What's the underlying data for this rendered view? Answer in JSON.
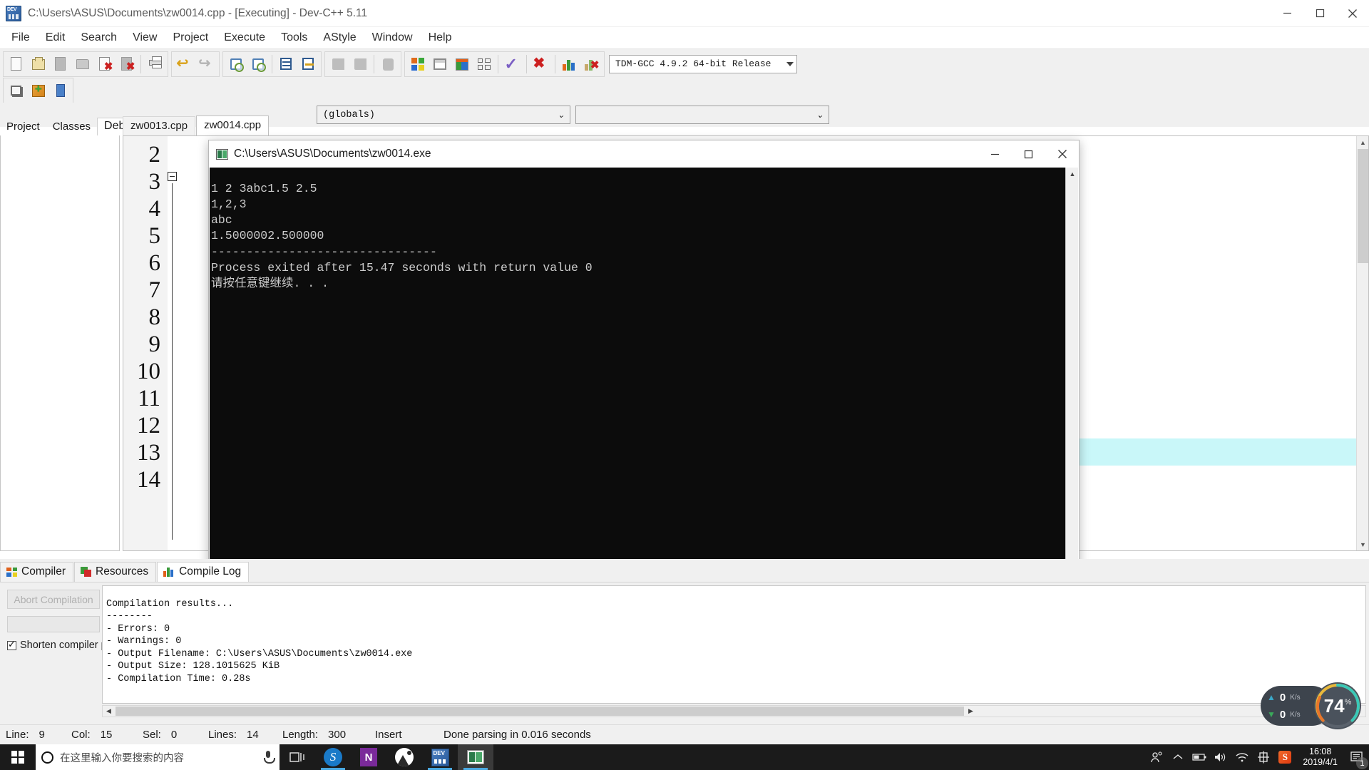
{
  "window": {
    "title": "C:\\Users\\ASUS\\Documents\\zw0014.cpp - [Executing] - Dev-C++ 5.11",
    "minimize": "–",
    "maximize": "☐",
    "close": "✕"
  },
  "menubar": {
    "items": [
      "File",
      "Edit",
      "Search",
      "View",
      "Project",
      "Execute",
      "Tools",
      "AStyle",
      "Window",
      "Help"
    ]
  },
  "toolbar": {
    "compiler_select": "TDM-GCC 4.9.2 64-bit Release",
    "buttons": [
      "new-file",
      "open-file",
      "save-file",
      "save-all",
      "close-file",
      "close-all",
      "print",
      "undo",
      "redo",
      "find",
      "replace",
      "goto-line",
      "goto-function",
      "cut",
      "copy",
      "paste",
      "compile",
      "run",
      "compile-and-run",
      "rebuild-all",
      "check-syntax",
      "stop-execution",
      "profile-analysis",
      "delete-profile"
    ]
  },
  "combos": {
    "scope": "(globals)",
    "member": ""
  },
  "left_tabs": {
    "items": [
      "Project",
      "Classes",
      "Debug"
    ],
    "active": "Debug"
  },
  "editor_tabs": {
    "items": [
      "zw0013.cpp",
      "zw0014.cpp"
    ],
    "active": "zw0014.cpp"
  },
  "editor": {
    "line_numbers": [
      "2",
      "3",
      "4",
      "5",
      "6",
      "7",
      "8",
      "9",
      "10",
      "11",
      "12",
      "13",
      "14"
    ],
    "highlight_color": "#c9f7f9"
  },
  "console": {
    "title": "C:\\Users\\ASUS\\Documents\\zw0014.exe",
    "minimize": "–",
    "maximize": "☐",
    "close": "✕",
    "output": "1 2 3abc1.5 2.5\n1,2,3\nabc\n1.5000002.500000\n--------------------------------\nProcess exited after 15.47 seconds with return value 0\n请按任意键继续. . .",
    "background": "#0c0c0c",
    "foreground": "#cccccc"
  },
  "bottom_tabs": {
    "items": [
      "Compiler",
      "Resources",
      "Compile Log"
    ],
    "active": "Compile Log"
  },
  "bottom_panel": {
    "abort_label": "Abort Compilation",
    "shorten_label": "Shorten compiler pa",
    "shorten_checked": true,
    "results": "Compilation results...\n--------\n- Errors: 0\n- Warnings: 0\n- Output Filename: C:\\Users\\ASUS\\Documents\\zw0014.exe\n- Output Size: 128.1015625 KiB\n- Compilation Time: 0.28s"
  },
  "statusbar": {
    "line_key": "Line:",
    "line_val": "9",
    "col_key": "Col:",
    "col_val": "15",
    "sel_key": "Sel:",
    "sel_val": "0",
    "lines_key": "Lines:",
    "lines_val": "14",
    "length_key": "Length:",
    "length_val": "300",
    "mode": "Insert",
    "parse": "Done parsing in 0.016 seconds"
  },
  "net_widget": {
    "up_value": "0",
    "up_unit": "K/s",
    "down_value": "0",
    "down_unit": "K/s",
    "cpu_value": "74",
    "cpu_unit": "%"
  },
  "taskbar": {
    "search_placeholder": "在这里输入你要搜索的内容",
    "apps": [
      "task-view",
      "sogou-browser",
      "onenote",
      "photos",
      "dev-cpp",
      "console-window"
    ],
    "tray": [
      "people",
      "show-hidden",
      "battery",
      "volume",
      "wifi",
      "ime-chinese",
      "sogou-ime"
    ],
    "time": "16:08",
    "date": "2019/4/1",
    "notification_count": "1"
  }
}
